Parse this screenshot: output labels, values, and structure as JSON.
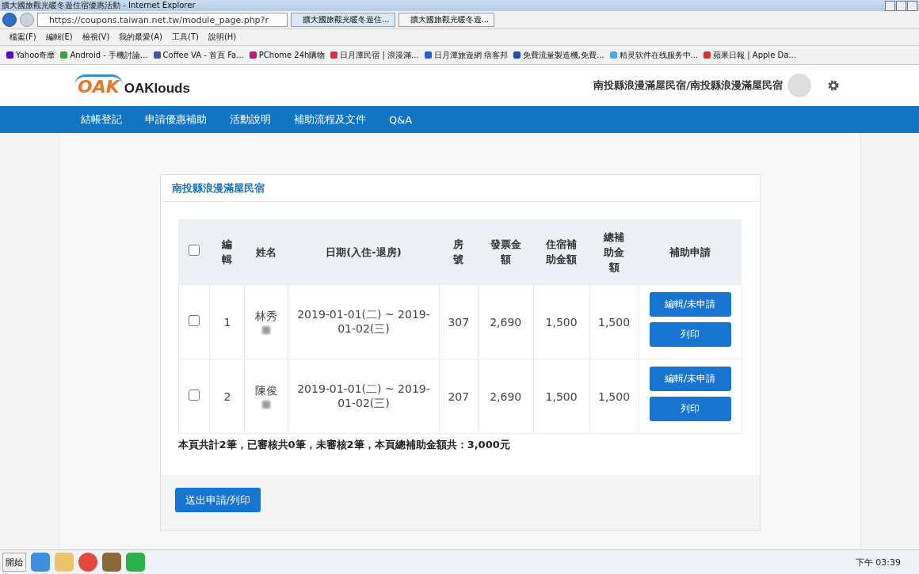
{
  "browser": {
    "title": "擴大國旅觀光暖冬遊住宿優惠活動 - Internet Explorer",
    "url": "https://coupons.taiwan.net.tw/module_page.php?r",
    "tabs": [
      {
        "label": "擴大國旅觀光暖冬遊住...",
        "selected": true
      },
      {
        "label": "擴大國旅觀光暖冬遊...",
        "selected": false
      }
    ],
    "menu": [
      "檔案(F)",
      "編輯(E)",
      "檢視(V)",
      "我的最愛(A)",
      "工具(T)",
      "說明(H)"
    ],
    "favorites": [
      {
        "label": "Yahoo奇摩",
        "color": "#5f01d1"
      },
      {
        "label": "Android - 手機討論...",
        "color": "#3aa53a"
      },
      {
        "label": "Coffee VA - 首頁  Fa...",
        "color": "#3b5998"
      },
      {
        "label": "PChome 24h購物",
        "color": "#c0168a"
      },
      {
        "label": "日月潭民宿 | 浪漫滿...",
        "color": "#e0304a"
      },
      {
        "label": "日月潭旅遊網  痞客邦",
        "color": "#2a5bd7"
      },
      {
        "label": "免費流量製造機,免費...",
        "color": "#1d4fa8"
      },
      {
        "label": "精灵软件在线服务中...",
        "color": "#4aa8e8"
      },
      {
        "label": "蘋果日報 | Apple Da...",
        "color": "#d8342a"
      }
    ]
  },
  "header": {
    "logo_mark": "OAK",
    "logo_text": "OAKlouds",
    "user": "南投縣浪漫滿屋民宿/南投縣浪漫滿屋民宿"
  },
  "nav": [
    "結帳登記",
    "申請優惠補助",
    "活動說明",
    "補助流程及文件",
    "Q&A"
  ],
  "card": {
    "title": "南投縣浪漫滿屋民宿",
    "table": {
      "select_all": {
        "checked": false
      },
      "columns": [
        "編輯",
        "姓名",
        "日期(入住-退房)",
        "房號",
        "發票金額",
        "住宿補助金額",
        "總補助金額",
        "補助申請"
      ],
      "rows": [
        {
          "checked": false,
          "no": "1",
          "name": "林秀",
          "dates": "2019-01-01(二) ~ 2019-01-02(三)",
          "room": "307",
          "invoice": "2,690",
          "lodging": "1,500",
          "total": "1,500",
          "buttons": [
            "編輯/未申請",
            "列印"
          ]
        },
        {
          "checked": false,
          "no": "2",
          "name": "陳俊",
          "dates": "2019-01-01(二) ~ 2019-01-02(三)",
          "room": "207",
          "invoice": "2,690",
          "lodging": "1,500",
          "total": "1,500",
          "buttons": [
            "編輯/未申請",
            "列印"
          ]
        }
      ]
    },
    "summary": "本頁共計2筆，已審核共0筆，未審核2筆，本頁總補助金額共：3,000元",
    "submit": "送出申請/列印"
  },
  "taskbar": {
    "start": "開始",
    "clock": "下午 03:39"
  }
}
